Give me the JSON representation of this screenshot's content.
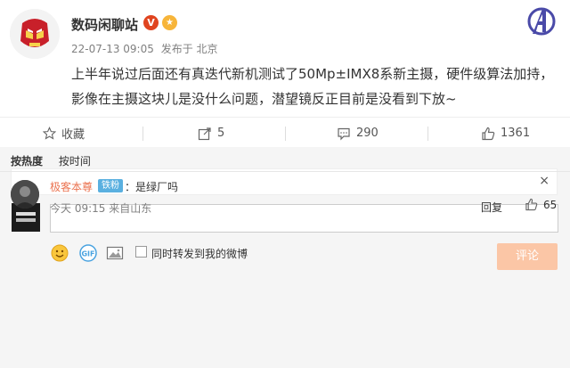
{
  "post": {
    "username": "数码闲聊站",
    "vip_badge": "V",
    "timestamp": "22-07-13 09:05",
    "source": "发布于 北京",
    "text": "上半年说过后面还有真迭代新机测试了50Mp±IMX8系新主摄，硬件级算法加持，影像在主摄这块儿是没什么问题，潜望镜反正目前是没看到下放~"
  },
  "actions": {
    "favorite": "收藏",
    "repost_count": "5",
    "comment_count": "290",
    "like_count": "1361"
  },
  "composer": {
    "share_label": "同时转发到我的微博",
    "submit_label": "评论",
    "notice_close": "×"
  },
  "sort": {
    "hot": "按热度",
    "time": "按时间"
  },
  "comment": {
    "name": "极客本尊",
    "fan_badge": "铁粉",
    "text": "：是绿厂吗",
    "time": "今天 09:15 来自山东",
    "reply": "回复",
    "likes": "65"
  },
  "colors": {
    "accent_orange": "#eb7350",
    "submit_disabled": "#fbc6a6",
    "vip_red": "#e0441f",
    "fan_blue": "#5ab0e0"
  }
}
